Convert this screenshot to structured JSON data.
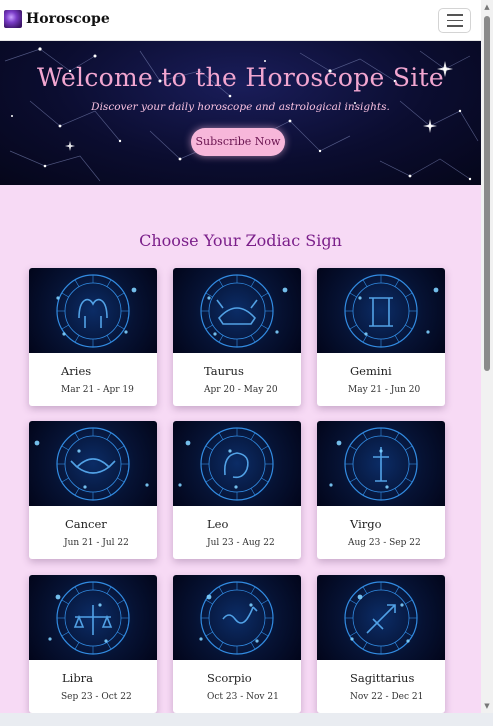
{
  "navbar": {
    "brand": "Horoscope",
    "logo_icon": "horoscope-logo",
    "menu_icon": "hamburger-menu-icon"
  },
  "hero": {
    "title": "Welcome to the Horoscope Site",
    "subtitle": "Discover your daily horoscope and astrological insights.",
    "button": "Subscribe Now"
  },
  "section": {
    "title": "Choose Your Zodiac Sign"
  },
  "signs": [
    {
      "name": "Aries",
      "dates": "Mar 21 - Apr 19",
      "icon": "aries-ram-icon"
    },
    {
      "name": "Taurus",
      "dates": "Apr 20 - May 20",
      "icon": "taurus-bull-icon"
    },
    {
      "name": "Gemini",
      "dates": "May 21 - Jun 20",
      "icon": "gemini-twins-icon"
    },
    {
      "name": "Cancer",
      "dates": "Jun 21 - Jul 22",
      "icon": "cancer-crab-icon"
    },
    {
      "name": "Leo",
      "dates": "Jul 23 - Aug 22",
      "icon": "leo-lion-icon"
    },
    {
      "name": "Virgo",
      "dates": "Aug 23 - Sep 22",
      "icon": "virgo-maiden-icon"
    },
    {
      "name": "Libra",
      "dates": "Sep 23 - Oct 22",
      "icon": "libra-scales-icon"
    },
    {
      "name": "Scorpio",
      "dates": "Oct 23 - Nov 21",
      "icon": "scorpio-scorpion-icon"
    },
    {
      "name": "Sagittarius",
      "dates": "Nov 22 - Dec 21",
      "icon": "sagittarius-archer-icon"
    }
  ],
  "colors": {
    "page_bg": "#f7daf5",
    "hero_title": "#f2a6d0",
    "button_bg": "#f7b7da",
    "section_title": "#7b1f8a",
    "zodiac_glow": "#3aa0ff"
  }
}
